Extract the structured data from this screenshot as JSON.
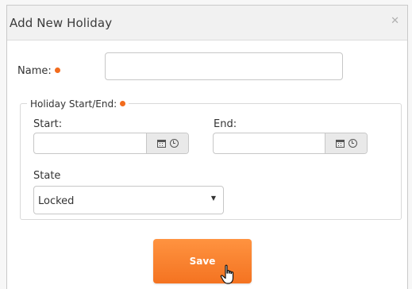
{
  "dialog": {
    "title": "Add New Holiday",
    "close_icon": "close-icon"
  },
  "form": {
    "name_label": "Name:",
    "name_value": "",
    "holiday_group_label": "Holiday Start/End:",
    "start_label": "Start:",
    "start_value": "",
    "end_label": "End:",
    "end_value": "",
    "state_label": "State",
    "state_value": "Locked",
    "save_label": "Save"
  },
  "colors": {
    "required_dot": "#f26b1d",
    "save_button": "#f47321"
  }
}
